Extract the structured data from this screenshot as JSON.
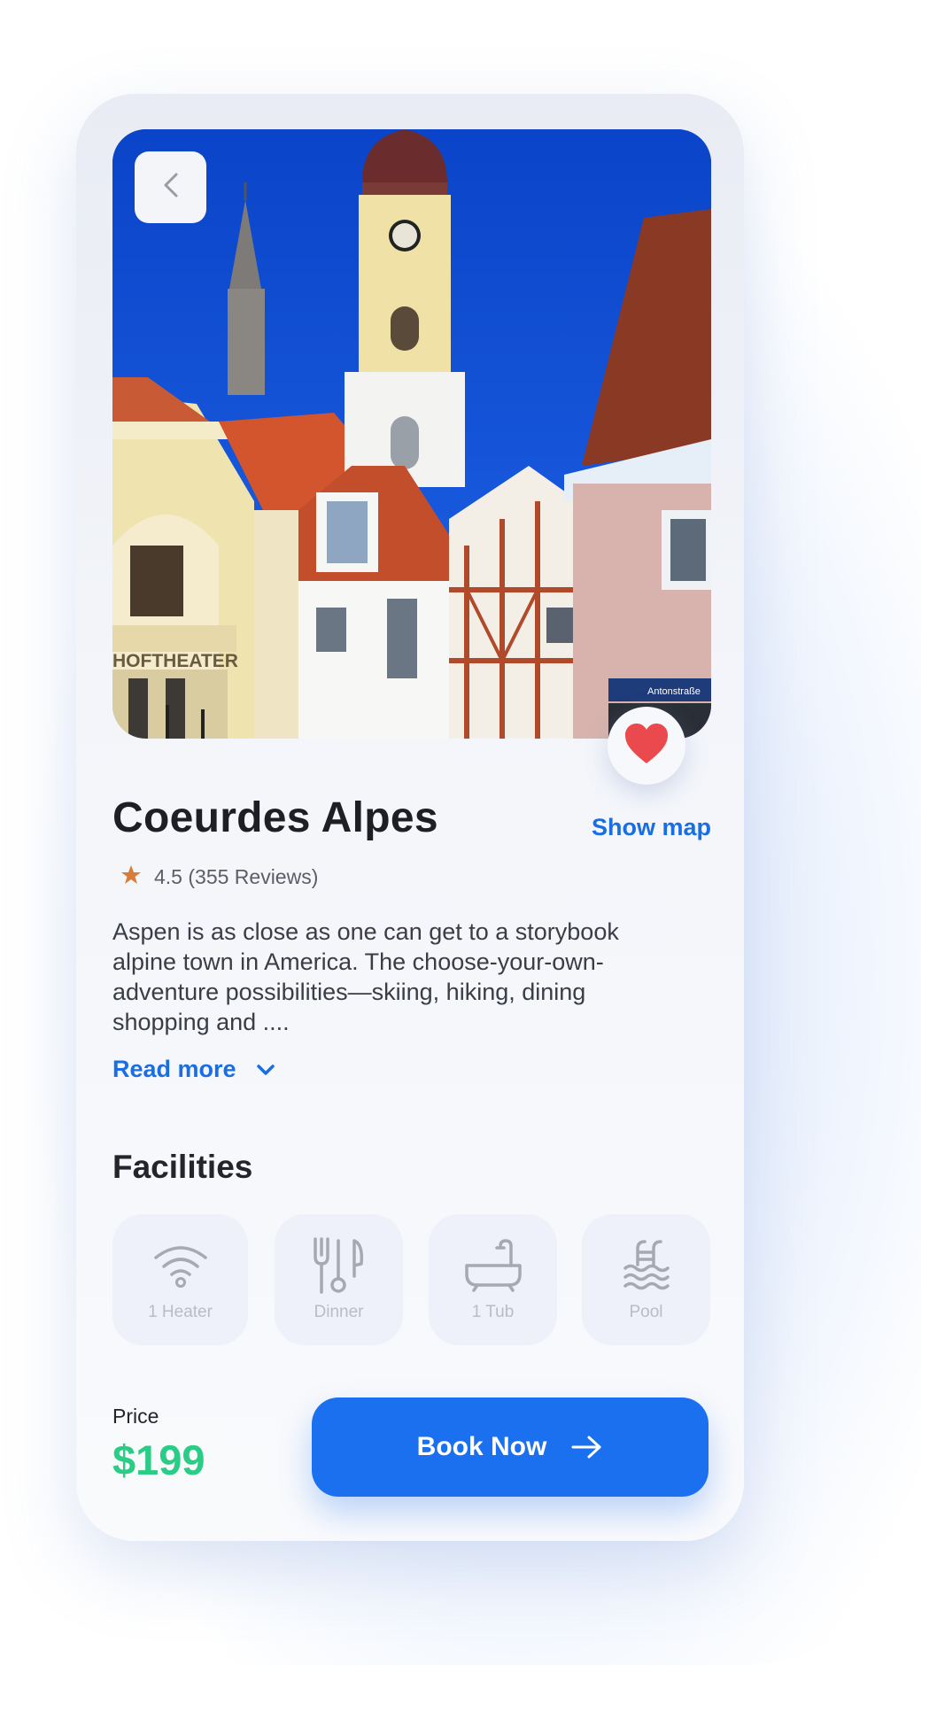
{
  "place": {
    "title": "Coeurdes Alpes",
    "show_map_label": "Show map",
    "rating_text": "4.5 (355 Reviews)",
    "description": "Aspen is as close as one can get to a storybook alpine town in America. The choose-your-own-adventure possibilities—skiing, hiking, dining shopping and ....",
    "read_more_label": "Read more",
    "photo_signs": {
      "building_sign": "HOFTHEATER",
      "street_sign": "Antonstraße"
    }
  },
  "facilities": {
    "title": "Facilities",
    "items": [
      {
        "label": "1 Heater",
        "icon": "wifi-icon"
      },
      {
        "label": "Dinner",
        "icon": "cutlery-icon"
      },
      {
        "label": "1 Tub",
        "icon": "bathtub-icon"
      },
      {
        "label": "Pool",
        "icon": "pool-icon"
      }
    ]
  },
  "footer": {
    "price_label": "Price",
    "price_value": "$199",
    "book_label": "Book Now"
  },
  "colors": {
    "accent": "#1b70ef",
    "price": "#2bcc86",
    "heart": "#ea4a4d",
    "star": "#d97c3a"
  }
}
